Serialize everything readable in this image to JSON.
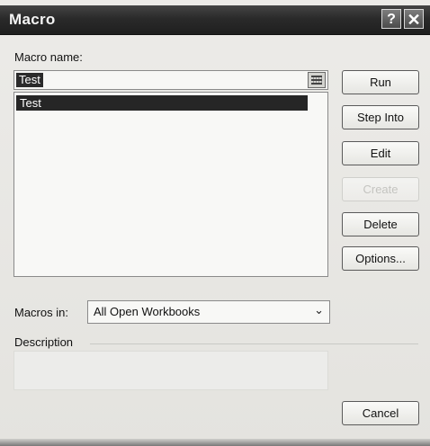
{
  "window": {
    "title": "Macro",
    "help_glyph": "?",
    "close_glyph": "✕"
  },
  "macro_name": {
    "label": "Macro name:",
    "value": "Test",
    "list_items": [
      "Test"
    ]
  },
  "buttons": {
    "run": "Run",
    "step_into": "Step Into",
    "edit": "Edit",
    "create": "Create",
    "delete": "Delete",
    "options": "Options...",
    "cancel": "Cancel"
  },
  "macros_in": {
    "label": "Macros in:",
    "value": "All Open Workbooks",
    "chevron": "⌄"
  },
  "description": {
    "label": "Description"
  },
  "colors": {
    "titlebar": "#2a2a2a",
    "selection": "#262626",
    "disabled_text": "#c4c4c0"
  }
}
